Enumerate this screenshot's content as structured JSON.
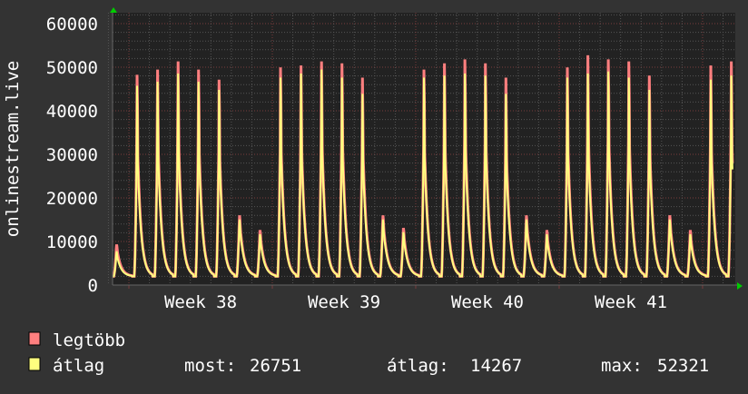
{
  "chart_data": {
    "type": "line",
    "title": "",
    "ylabel": "onlinestream.live",
    "xlabel": "",
    "ylim": [
      0,
      62500
    ],
    "yticks": [
      "0",
      "10000",
      "20000",
      "30000",
      "40000",
      "50000",
      "60000"
    ],
    "ytick_values": [
      0,
      10000,
      20000,
      30000,
      40000,
      50000,
      60000
    ],
    "xticks": [
      "Week 38",
      "Week 39",
      "Week 40",
      "Week 41"
    ],
    "x_unit": "days since start of Week 38",
    "xlim": [
      -0.8,
      29.5
    ],
    "grid": true,
    "legend_placement": "bottom-left",
    "colors": {
      "max": "#ff7f7f",
      "avg": "#ffff7f",
      "grid_minor": "#555555",
      "grid_major": "#7a3c3c",
      "arrow": "#00cc00"
    },
    "series": [
      {
        "name": "legtöbb",
        "key": "max"
      },
      {
        "name": "átlag",
        "key": "avg"
      }
    ],
    "daily_peaks": {
      "day_offsets": [
        -1,
        0,
        1,
        2,
        3,
        4,
        5,
        6,
        7,
        8,
        9,
        10,
        11,
        12,
        13,
        14,
        15,
        16,
        17,
        18,
        19,
        20,
        21,
        22,
        23,
        24,
        25,
        26,
        27,
        28,
        29
      ],
      "max": [
        9600,
        51700,
        53000,
        55000,
        53000,
        50500,
        16500,
        13000,
        53500,
        54000,
        55000,
        54500,
        51000,
        16500,
        13500,
        53000,
        54500,
        55500,
        54500,
        51000,
        16500,
        13000,
        53500,
        56500,
        55500,
        55000,
        51500,
        16500,
        13000,
        54000,
        55000
      ],
      "avg": [
        8000,
        49000,
        50000,
        52000,
        50000,
        48000,
        15500,
        12000,
        51000,
        52000,
        53000,
        51000,
        47000,
        15500,
        12500,
        51000,
        51500,
        52000,
        51500,
        47000,
        15500,
        12000,
        51000,
        52000,
        52500,
        51000,
        48000,
        15500,
        12000,
        50500,
        51500
      ]
    },
    "last_value": 26751,
    "stats": {
      "now_label": "most:",
      "now": "26751",
      "avg_label": "átlag:",
      "avg": "14267",
      "max_label": "max:",
      "max": "52321"
    }
  }
}
